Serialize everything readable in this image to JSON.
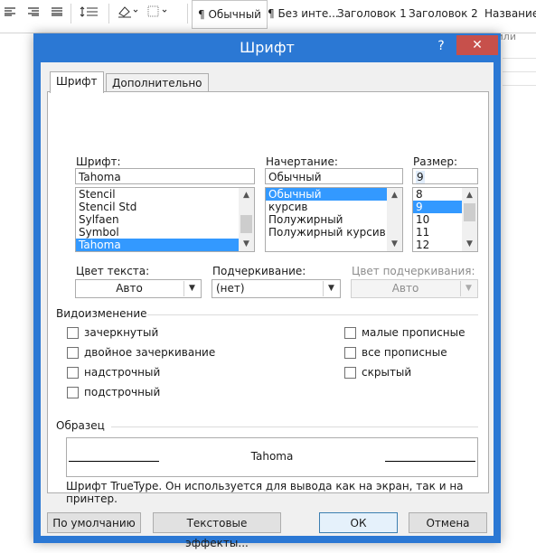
{
  "ribbon": {
    "styles": [
      "¶ Обычный",
      "¶ Без инте...",
      "Заголовок 1",
      "Заголовок 2",
      "Название"
    ],
    "group_label": "или"
  },
  "dialog": {
    "title": "Шрифт",
    "help": "?",
    "close": "✕",
    "tabs": [
      "Шрифт",
      "Дополнительно"
    ],
    "font": {
      "label": "Шрифт:",
      "value": "Tahoma",
      "items": [
        "Stencil",
        "Stencil Std",
        "Sylfaen",
        "Symbol",
        "Tahoma"
      ],
      "selected": "Tahoma"
    },
    "style": {
      "label": "Начертание:",
      "value": "Обычный",
      "items": [
        "Обычный",
        "курсив",
        "Полужирный",
        "Полужирный курсив"
      ],
      "selected": "Обычный"
    },
    "size": {
      "label": "Размер:",
      "value": "9",
      "items": [
        "8",
        "9",
        "10",
        "11",
        "12"
      ],
      "selected": "9"
    },
    "text_color": {
      "label": "Цвет текста:",
      "value": "Авто"
    },
    "underline": {
      "label": "Подчеркивание:",
      "value": "(нет)"
    },
    "underline_color": {
      "label": "Цвет подчеркивания:",
      "value": "Авто",
      "disabled": true
    },
    "effects": {
      "title": "Видоизменение",
      "left": [
        "зачеркнутый",
        "двойное зачеркивание",
        "надстрочный",
        "подстрочный"
      ],
      "right": [
        "малые прописные",
        "все прописные",
        "скрытый"
      ]
    },
    "preview": {
      "title": "Образец",
      "text": "Tahoma",
      "note": "Шрифт TrueType. Он используется для вывода как на экран, так и на принтер."
    },
    "buttons": {
      "default": "По умолчанию",
      "text_effects": "Текстовые эффекты...",
      "ok": "ОК",
      "cancel": "Отмена"
    }
  },
  "colors": {
    "titlebar": "#2b78d4",
    "close": "#c7504b",
    "selection": "#3399ff"
  }
}
